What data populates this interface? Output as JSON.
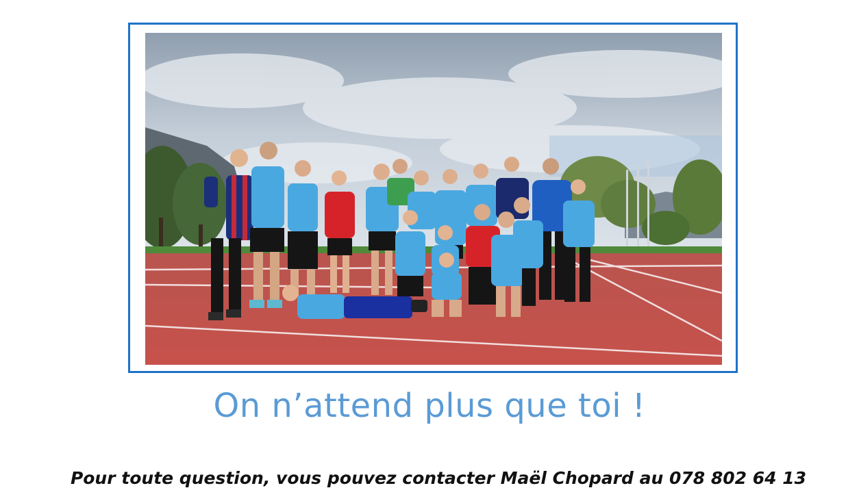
{
  "photo": {
    "subject": "group-photo-athletics-track",
    "colors": {
      "frame_border": "#1f73c8",
      "sky": "#b9c6d4",
      "track": "#c44f4a",
      "jersey_light_blue": "#4aa8e0",
      "jersey_red": "#d6232a",
      "jersey_navy": "#1a2a6c",
      "grass": "#4f8a3a"
    }
  },
  "headline": {
    "text": "On n’attend plus que toi !",
    "color": "#5b9bd5"
  },
  "contact": {
    "text": "Pour toute question, vous pouvez contacter Maël Chopard au 078 802 64 13"
  }
}
